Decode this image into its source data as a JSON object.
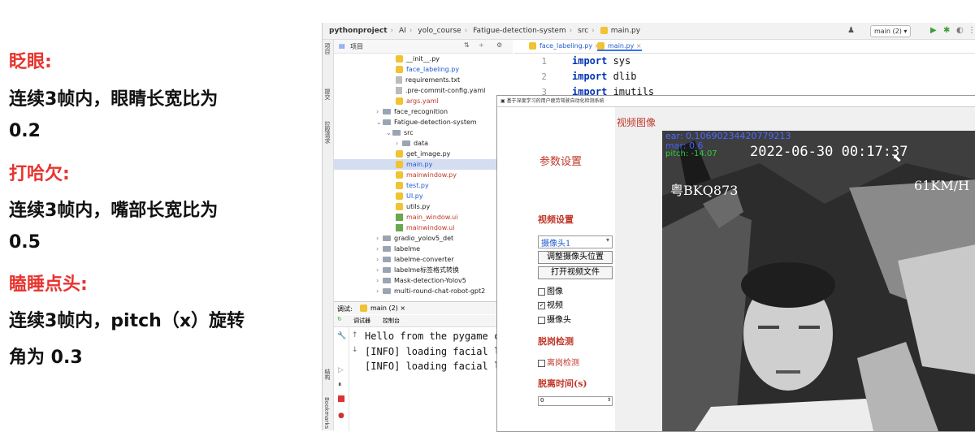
{
  "notes": {
    "eye_title": "眨眼:",
    "eye_desc1": "连续3帧内，眼睛长宽比为",
    "eye_desc2": "0.2",
    "yawn_title": "打哈欠:",
    "yawn_desc1": "连续3帧内，嘴部长宽比为",
    "yawn_desc2": "0.5",
    "nod_title": "瞌睡点头:",
    "nod_desc1": "连续3帧内，pitch（x）旋转",
    "nod_desc2": "角为 0.3"
  },
  "ide": {
    "breadcrumbs": [
      "pythonproject",
      "AI",
      "yolo_course",
      "Fatigue-detection-system",
      "src",
      "main.py"
    ],
    "branch": "main (2)",
    "left_strip": [
      "项目",
      "提交",
      "拉取请求"
    ],
    "project_label": "项目",
    "tree": [
      {
        "name": "__init__.py",
        "kind": "py",
        "indent": 4,
        "color": "normal"
      },
      {
        "name": "face_labeling.py",
        "kind": "py",
        "indent": 4,
        "color": "blue"
      },
      {
        "name": "requirements.txt",
        "kind": "txt",
        "indent": 4,
        "color": "normal"
      },
      {
        "name": ".pre-commit-config.yaml",
        "kind": "txt",
        "indent": 4,
        "color": "normal"
      },
      {
        "name": "args.yaml",
        "kind": "py",
        "indent": 4,
        "color": "orange"
      },
      {
        "name": "face_recognition",
        "kind": "folder",
        "indent": 2,
        "color": "normal"
      },
      {
        "name": "Fatigue-detection-system",
        "kind": "folder",
        "indent": 2,
        "color": "normal"
      },
      {
        "name": "src",
        "kind": "folder",
        "indent": 3,
        "color": "normal"
      },
      {
        "name": "data",
        "kind": "folder",
        "indent": 4,
        "color": "normal"
      },
      {
        "name": "get_image.py",
        "kind": "py",
        "indent": 4,
        "color": "normal"
      },
      {
        "name": "main.py",
        "kind": "py",
        "indent": 4,
        "color": "blue"
      },
      {
        "name": "mainwindow.py",
        "kind": "py",
        "indent": 4,
        "color": "orange"
      },
      {
        "name": "test.py",
        "kind": "py",
        "indent": 4,
        "color": "blue"
      },
      {
        "name": "UI.py",
        "kind": "py",
        "indent": 4,
        "color": "blue"
      },
      {
        "name": "utils.py",
        "kind": "py",
        "indent": 4,
        "color": "normal"
      },
      {
        "name": "main_window.ui",
        "kind": "ui",
        "indent": 4,
        "color": "orange"
      },
      {
        "name": "mainwindow.ui",
        "kind": "ui",
        "indent": 4,
        "color": "orange"
      },
      {
        "name": "gradio_yolov5_det",
        "kind": "folder",
        "indent": 2,
        "color": "normal"
      },
      {
        "name": "labelme",
        "kind": "folder",
        "indent": 2,
        "color": "normal"
      },
      {
        "name": "labelme-converter",
        "kind": "folder",
        "indent": 2,
        "color": "normal"
      },
      {
        "name": "labelme标签格式转换",
        "kind": "folder",
        "indent": 2,
        "color": "normal"
      },
      {
        "name": "Mask-detection-Yolov5",
        "kind": "folder",
        "indent": 2,
        "color": "normal"
      },
      {
        "name": "multi-round-chat-robot-gpt2",
        "kind": "folder",
        "indent": 2,
        "color": "normal"
      }
    ],
    "editor_tabs": [
      "face_labeling.py",
      "main.py"
    ],
    "code_lines": [
      {
        "num": "1",
        "kw": "import",
        "rest": " sys"
      },
      {
        "num": "2",
        "kw": "import",
        "rest": " dlib"
      },
      {
        "num": "3",
        "kw": "import",
        "rest": " imutils"
      }
    ],
    "debug": {
      "label": "调试:",
      "run_name": "main (2)",
      "tabs": [
        "调试器",
        "控制台"
      ],
      "console": [
        "Hello from the pygame co",
        "[INFO] loading facial la",
        "[INFO] loading facial la"
      ]
    },
    "bookmarks": "Bookmarks",
    "structure": "结构"
  },
  "app": {
    "title": "基于深度学习的用户疲劳驾驶自动化检测系统",
    "video_label": "视频图像",
    "params": "参数设置",
    "video_settings": "视频设置",
    "camera_select": "摄像头1",
    "adjust_btn": "调整摄像头位置",
    "open_btn": "打开视频文件",
    "chk_image": "图像",
    "chk_video": "视频",
    "chk_camera": "摄像头",
    "leave_detect": "脱岗检测",
    "leave_chk": "离岗检测",
    "leave_time": "脱离时间(s)",
    "spin_value": "0",
    "overlay": {
      "ear": "ear: 0.10690234420779213",
      "mar": "mar: 0.6",
      "pitch": "pitch: -14.07",
      "datetime": "2022-06-30 00:17:37",
      "plate": "粤BKQ873",
      "speed": "61KM/H"
    }
  },
  "colors": {
    "red_title": "#e8342f",
    "ide_blue": "#1f5bd1",
    "ide_orange": "#c0392b",
    "app_red": "#c0392b"
  }
}
